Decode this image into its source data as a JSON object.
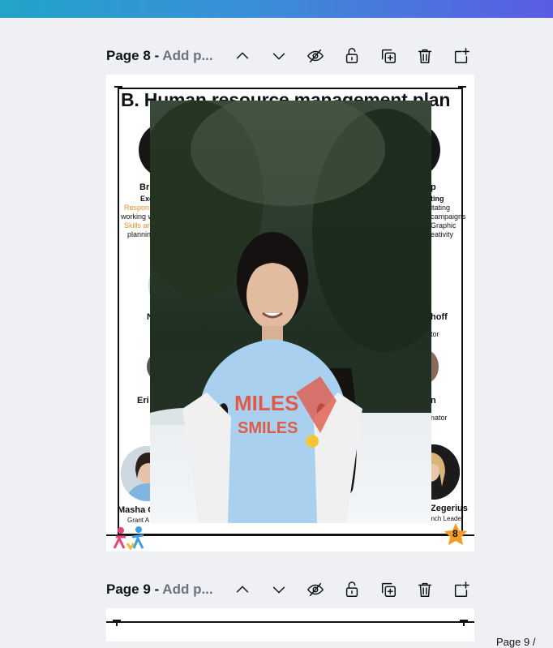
{
  "pages": [
    {
      "label": "Page 8 - ",
      "title_placeholder": "Add p..."
    },
    {
      "label": "Page 9 - ",
      "title_placeholder": "Add p..."
    }
  ],
  "page_controls": [
    "move-up",
    "move-down",
    "hide",
    "lock",
    "duplicate",
    "delete",
    "add-page"
  ],
  "design": {
    "title": "B. Human resource management plan",
    "snippets": {
      "left": [
        "Bri",
        "Exe",
        "Respon",
        "working w",
        "Skills an",
        "plannin",
        "N",
        "Eri",
        "Masha C",
        "Grant A"
      ],
      "right": [
        "p",
        "ting",
        "itating",
        "campaigns",
        "Graphic",
        "eativity",
        "hoff",
        "tor",
        "n",
        "nator",
        "Zegerius",
        "anch Leader"
      ]
    },
    "page_number_badge": "8"
  },
  "footer_page_indicator": "Page 9 /",
  "colors": {
    "accent_orange": "#e8912a",
    "topbar_start": "#22a3c9",
    "topbar_end": "#5b5ce3"
  }
}
